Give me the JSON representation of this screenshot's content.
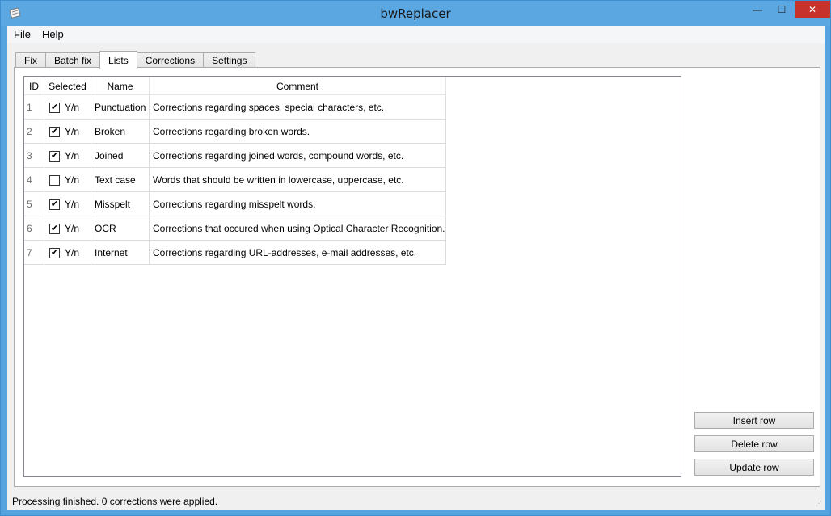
{
  "window": {
    "title": "bwReplacer",
    "icon": "app-icon",
    "controls": {
      "minimize": "—",
      "maximize": "☐",
      "close": "✕"
    }
  },
  "menu": [
    "File",
    "Help"
  ],
  "tabs": [
    {
      "label": "Fix",
      "active": false
    },
    {
      "label": "Batch fix",
      "active": false
    },
    {
      "label": "Lists",
      "active": true
    },
    {
      "label": "Corrections",
      "active": false
    },
    {
      "label": "Settings",
      "active": false
    }
  ],
  "table": {
    "columns": [
      "ID",
      "Selected",
      "Name",
      "Comment"
    ],
    "rows": [
      {
        "id": "1",
        "checked": true,
        "selected": "Y/n",
        "name": "Punctuation",
        "comment": "Corrections regarding spaces, special characters, etc."
      },
      {
        "id": "2",
        "checked": true,
        "selected": "Y/n",
        "name": "Broken",
        "comment": "Corrections regarding broken words."
      },
      {
        "id": "3",
        "checked": true,
        "selected": "Y/n",
        "name": "Joined",
        "comment": "Corrections regarding joined words, compound words, etc."
      },
      {
        "id": "4",
        "checked": false,
        "selected": "Y/n",
        "name": "Text case",
        "comment": "Words that should be written in lowercase, uppercase, etc."
      },
      {
        "id": "5",
        "checked": true,
        "selected": "Y/n",
        "name": "Misspelt",
        "comment": "Corrections regarding misspelt words."
      },
      {
        "id": "6",
        "checked": true,
        "selected": "Y/n",
        "name": "OCR",
        "comment": "Corrections that occured when using Optical Character Recognition."
      },
      {
        "id": "7",
        "checked": true,
        "selected": "Y/n",
        "name": "Internet",
        "comment": "Corrections regarding URL-addresses, e-mail addresses, etc."
      }
    ]
  },
  "buttons": {
    "insert": "Insert row",
    "delete": "Delete row",
    "update": "Update row"
  },
  "status": "Processing finished. 0 corrections were applied.",
  "colors": {
    "titlebar": "#5aa7e2",
    "close": "#c7322d"
  }
}
